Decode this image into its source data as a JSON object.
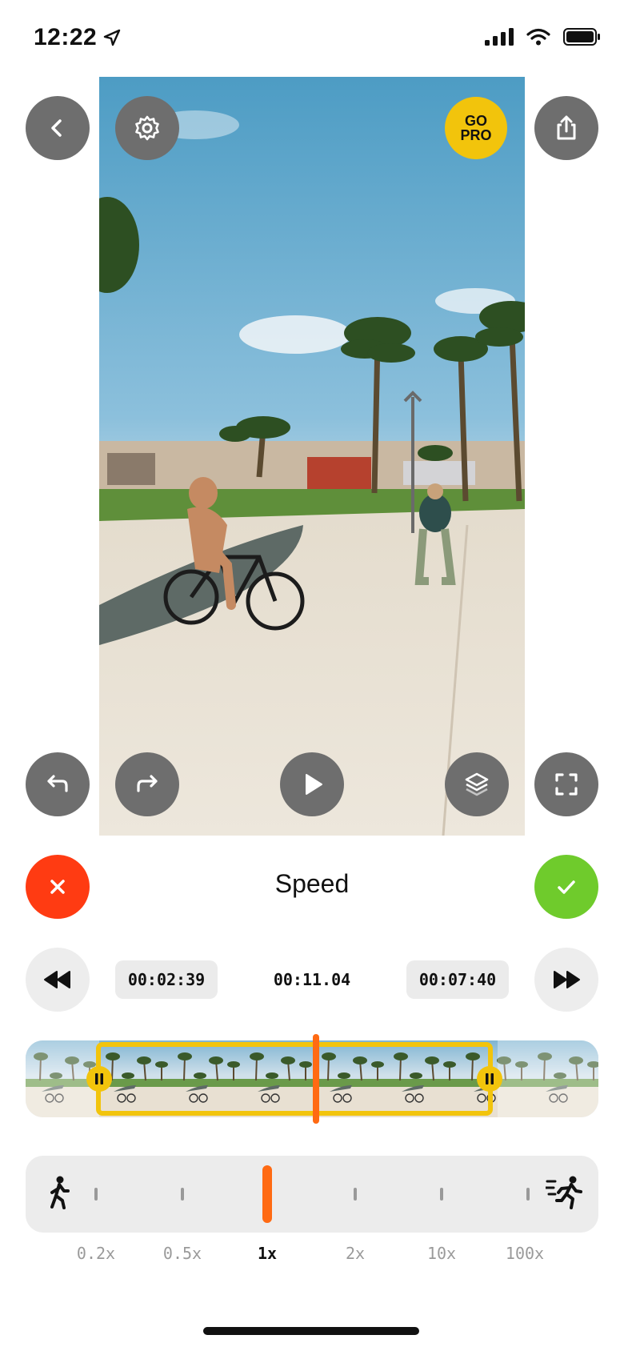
{
  "status_bar": {
    "time": "12:22"
  },
  "editor": {
    "title": "Speed",
    "go_pro_label": "GO\nPRO"
  },
  "time_row": {
    "start": "00:02:39",
    "current": "00:11.04",
    "end": "00:07:40"
  },
  "speed": {
    "options": [
      "0.2x",
      "0.5x",
      "1x",
      "2x",
      "10x",
      "100x"
    ],
    "selected": "1x"
  },
  "icons": {
    "back": "chevron-left-icon",
    "settings": "gear-icon",
    "share": "share-icon",
    "undo": "undo-icon",
    "redo": "redo-icon",
    "play": "play-icon",
    "layers": "layers-icon",
    "fullscreen": "fullscreen-icon",
    "cancel": "close-icon",
    "confirm": "check-icon",
    "rewind": "rewind-icon",
    "forward": "fast-forward-icon",
    "slow": "walking-icon",
    "fast": "running-icon"
  },
  "colors": {
    "accent": "#ff6a13",
    "trim": "#f2c40c",
    "cancel": "#ff3b12",
    "confirm": "#6fcb2c",
    "button": "#6e6e6e"
  }
}
